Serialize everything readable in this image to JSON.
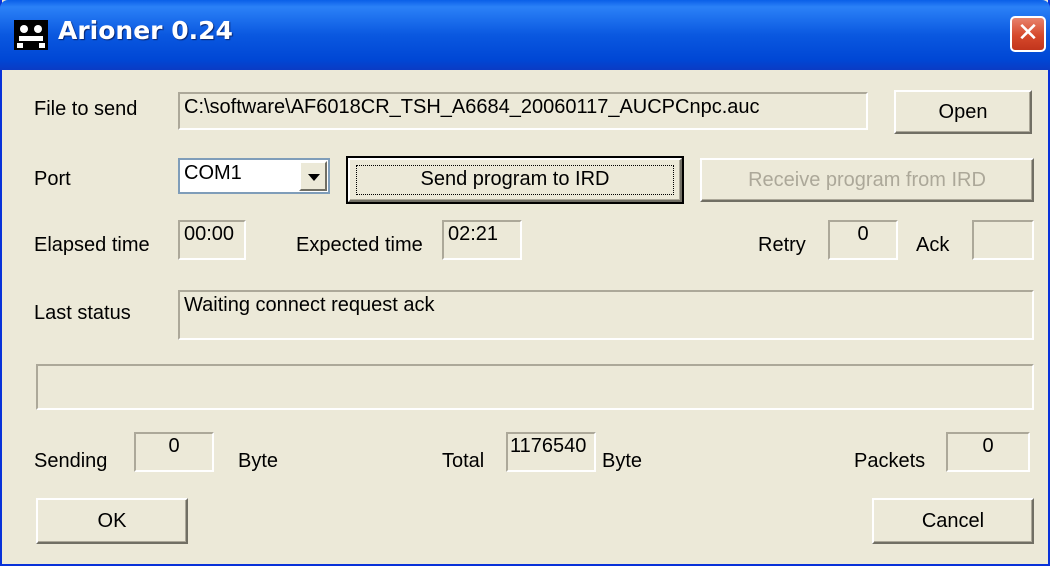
{
  "window": {
    "title": "Arioner 0.24",
    "close_glyph": "✕",
    "icon": "app-icon"
  },
  "file": {
    "label": "File to send",
    "value": "C:\\software\\AF6018CR_TSH_A6684_20060117_AUCPCnpc.auc",
    "open_label": "Open"
  },
  "port": {
    "label": "Port",
    "selected": "COM1"
  },
  "buttons": {
    "send": "Send program to IRD",
    "receive": "Receive program from IRD",
    "ok": "OK",
    "cancel": "Cancel"
  },
  "times": {
    "elapsed_label": "Elapsed time",
    "elapsed_value": "00:00",
    "expected_label": "Expected time",
    "expected_value": "02:21"
  },
  "retry": {
    "label": "Retry",
    "value": "0"
  },
  "ack": {
    "label": "Ack",
    "value": ""
  },
  "status": {
    "label": "Last status",
    "value": "Waiting connect request ack"
  },
  "progress": {
    "fraction": 0
  },
  "sending": {
    "label": "Sending",
    "value": "0",
    "unit": "Byte"
  },
  "total": {
    "label": "Total",
    "value": "1176540",
    "unit": "Byte"
  },
  "packets": {
    "label": "Packets",
    "value": "0"
  }
}
